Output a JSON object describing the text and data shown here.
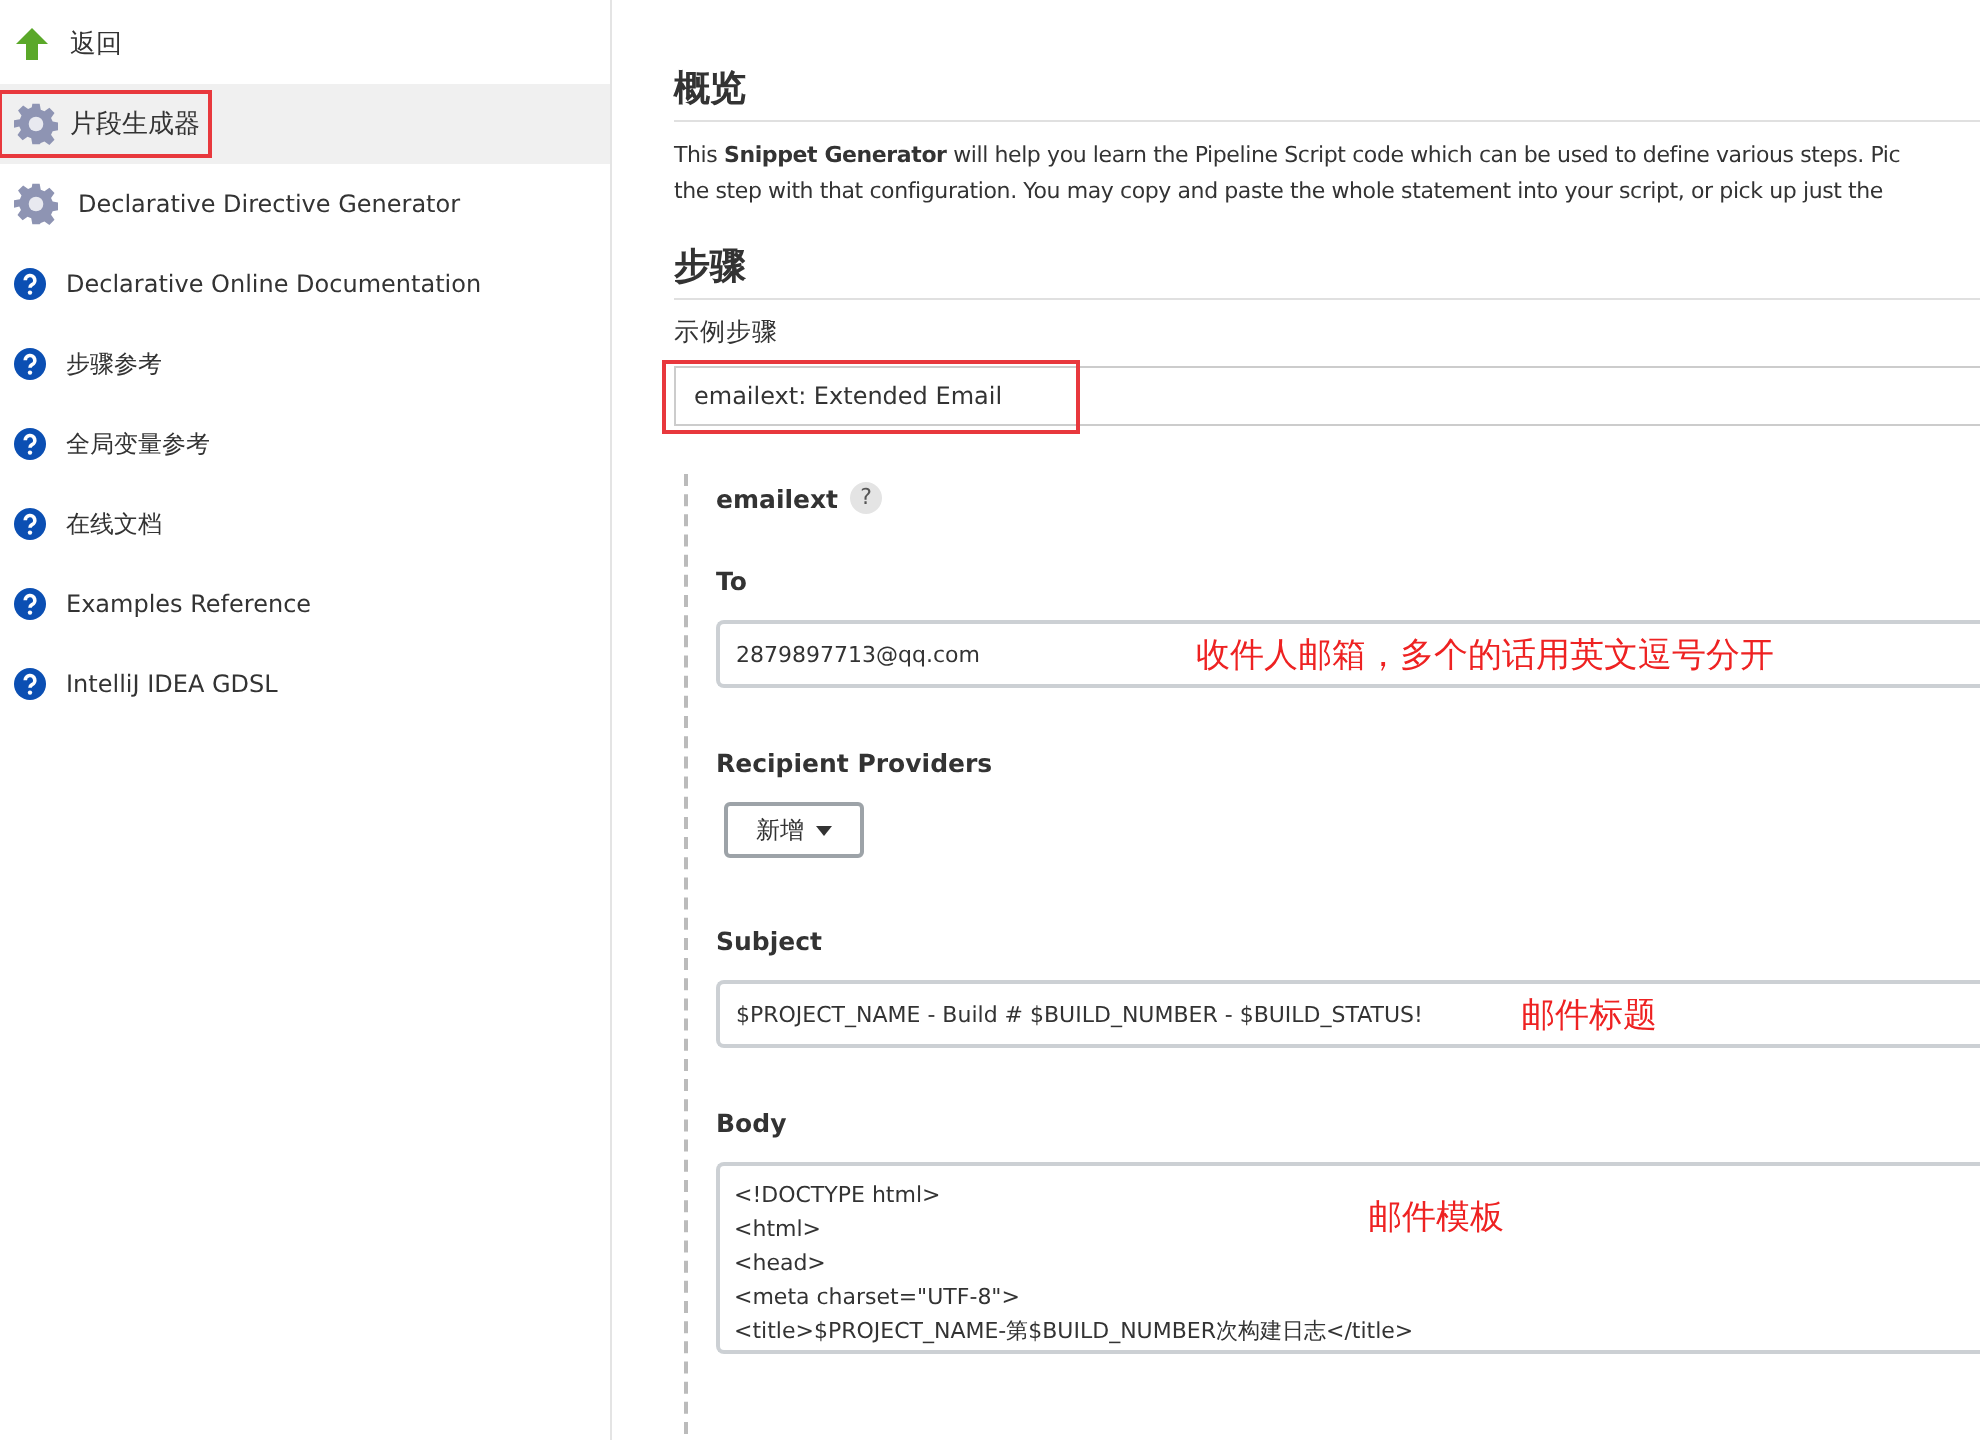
{
  "sidebar": {
    "items": [
      {
        "kind": "back",
        "label": "返回",
        "selected": false,
        "highlighted": false
      },
      {
        "kind": "gear",
        "label": "片段生成器",
        "selected": true,
        "highlighted": true
      },
      {
        "kind": "gear",
        "label": "Declarative Directive Generator",
        "selected": false,
        "highlighted": false
      },
      {
        "kind": "help",
        "label": "Declarative Online Documentation",
        "selected": false,
        "highlighted": false
      },
      {
        "kind": "help",
        "label": "步骤参考",
        "selected": false,
        "highlighted": false
      },
      {
        "kind": "help",
        "label": "全局变量参考",
        "selected": false,
        "highlighted": false
      },
      {
        "kind": "help",
        "label": "在线文档",
        "selected": false,
        "highlighted": false
      },
      {
        "kind": "help",
        "label": "Examples Reference",
        "selected": false,
        "highlighted": false
      },
      {
        "kind": "help",
        "label": "IntelliJ IDEA GDSL",
        "selected": false,
        "highlighted": false
      }
    ]
  },
  "overview": {
    "heading": "概览",
    "description_lines": [
      "This **Snippet Generator** will help you learn the Pipeline Script code which can be used to define various steps. Pic",
      "the step with that configuration. You may copy and paste the whole statement into your script, or pick up just the"
    ]
  },
  "steps": {
    "heading": "步骤",
    "sample_label": "示例步骤",
    "sample_value": "emailext: Extended Email",
    "sample_highlighted": true
  },
  "emailext": {
    "title": "emailext",
    "help": "?",
    "fields": [
      {
        "kind": "input",
        "label": "To",
        "value": "2879897713@qq.com",
        "annotation": "收件人邮箱，多个的话用英文逗号分开"
      },
      {
        "kind": "dropdown",
        "label": "Recipient Providers",
        "button": "新增"
      },
      {
        "kind": "input",
        "label": "Subject",
        "value": "$PROJECT_NAME - Build # $BUILD_NUMBER - $BUILD_STATUS!",
        "annotation": "邮件标题"
      },
      {
        "kind": "textarea",
        "label": "Body",
        "lines": [
          "<!DOCTYPE html>",
          "<html>",
          "<head>",
          "<meta charset=\"UTF-8\">",
          "<title>$PROJECT_NAME-第$BUILD_NUMBER次构建日志</title>"
        ],
        "annotation": "邮件模板"
      }
    ]
  }
}
